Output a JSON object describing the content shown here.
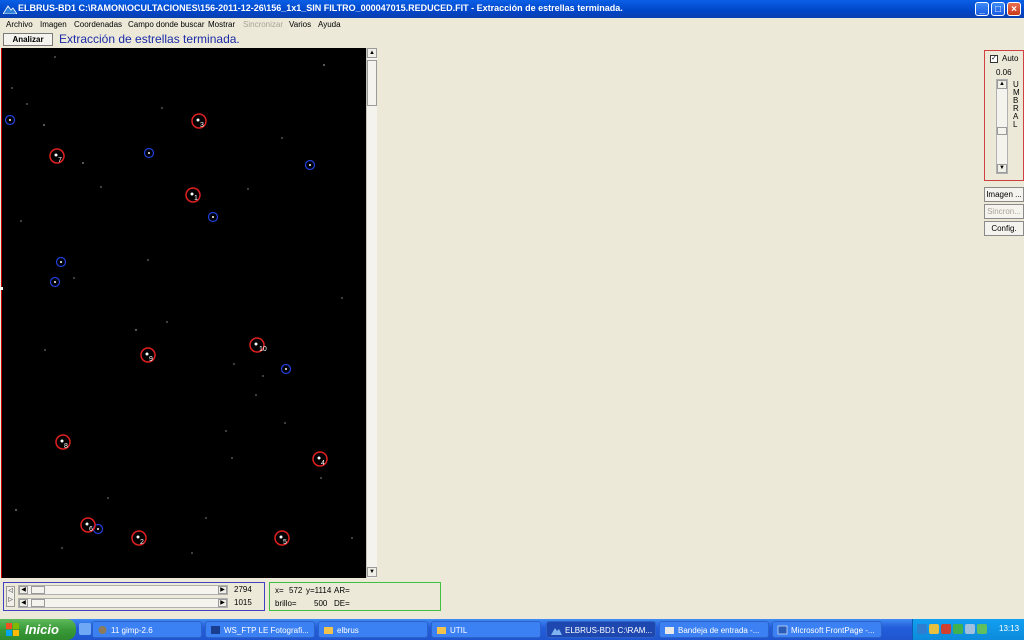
{
  "window": {
    "title": "ELBRUS-BD1  C:\\RAMON\\OCULTACIONES\\156-2011-12-26\\156_1x1_SIN FILTRO_000047015.REDUCED.FIT - Extracción de estrellas terminada.",
    "minimize": "_",
    "maximize": "□",
    "close": "×"
  },
  "menu": [
    {
      "label": "Archivo",
      "enabled": true
    },
    {
      "label": "Imagen",
      "enabled": true
    },
    {
      "label": "Coordenadas",
      "enabled": true
    },
    {
      "label": "Campo donde buscar",
      "enabled": true
    },
    {
      "label": "Mostrar",
      "enabled": true
    },
    {
      "label": "Sincronizar",
      "enabled": false
    },
    {
      "label": "Varios",
      "enabled": true
    },
    {
      "label": "Ayuda",
      "enabled": true
    }
  ],
  "toolbar": {
    "analyze_label": "Analizar",
    "status": "Extracción de estrellas terminada."
  },
  "stars": [
    {
      "label": "1",
      "color": "red"
    },
    {
      "label": "2",
      "color": "red"
    },
    {
      "label": "3",
      "color": "red"
    },
    {
      "label": "4",
      "color": "red"
    },
    {
      "label": "5",
      "color": "red"
    },
    {
      "label": "6",
      "color": "red"
    },
    {
      "label": "7",
      "color": "red"
    },
    {
      "label": "8",
      "color": "red"
    },
    {
      "label": "9",
      "color": "red"
    },
    {
      "label": "10",
      "color": "red"
    }
  ],
  "bottom": {
    "scroll_x_value": "2794",
    "scroll_y_value": "1015",
    "x_label": "x=",
    "x_value": "572",
    "y_label": "y=1114",
    "ar_label": "AR=",
    "brillo_label": "brillo=",
    "brillo_value": "500",
    "de_label": "DE="
  },
  "right_panel": {
    "auto_label": "Auto",
    "auto_checked": "✓",
    "umbral_value": "0.06",
    "umbral_letters": [
      "U",
      "M",
      "B",
      "R",
      "A",
      "L"
    ],
    "imagen_button": "Imagen ...",
    "sincron_button": "Sincron...",
    "config_button": "Config."
  },
  "taskbar": {
    "start_label": "Inicio",
    "items": [
      {
        "label": "11 gimp-2.6",
        "active": false
      },
      {
        "label": "WS_FTP LE Fotografi...",
        "active": false
      },
      {
        "label": "elbrus",
        "active": false
      },
      {
        "label": "UTIL",
        "active": false
      },
      {
        "label": "ELBRUS-BD1 C:\\RAM...",
        "active": true
      },
      {
        "label": "Bandeja de entrada -...",
        "active": false
      },
      {
        "label": "Microsoft FrontPage -...",
        "active": false
      }
    ],
    "clock": "13:13"
  },
  "colors": {
    "titlebar": "#0046C8",
    "status_text": "#1B2BA8",
    "marker_red": "#E02020",
    "marker_blue": "#2040E0",
    "taskbar": "#245EDB",
    "start": "#3A9A38"
  }
}
